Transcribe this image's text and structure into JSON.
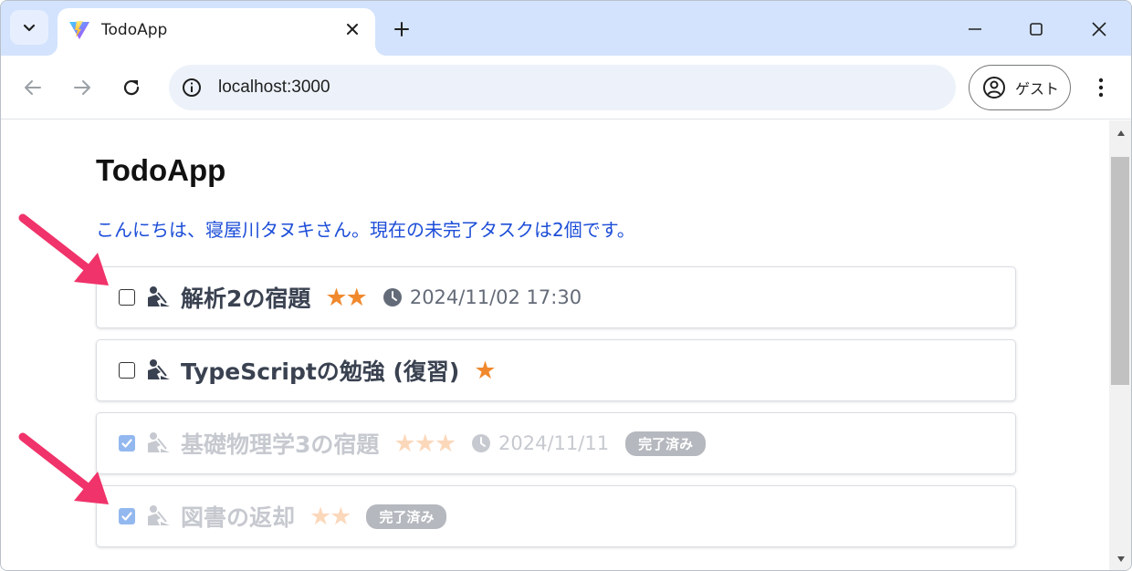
{
  "browser": {
    "tab_title": "TodoApp",
    "new_tab_label": "+",
    "url": "localhost:3000",
    "profile_label": "ゲスト"
  },
  "page": {
    "title": "TodoApp",
    "greeting": "こんにちは、寝屋川タヌキさん。現在の未完了タスクは2個です。"
  },
  "todos": [
    {
      "name": "解析2の宿題",
      "stars": "★★",
      "priority": 2,
      "due": "2024/11/02 17:30",
      "done": false
    },
    {
      "name": "TypeScriptの勉強 (復習)",
      "stars": "★",
      "priority": 1,
      "due": "",
      "done": false
    },
    {
      "name": "基礎物理学3の宿題",
      "stars": "★★★",
      "priority": 3,
      "due": "2024/11/11",
      "done": true,
      "badge": "完了済み"
    },
    {
      "name": "図書の返却",
      "stars": "★★",
      "priority": 2,
      "due": "",
      "done": true,
      "badge": "完了済み"
    }
  ],
  "colors": {
    "accent": "#1d4ed8",
    "star": "#f0892e",
    "tabstrip": "#d3e3fd",
    "annotation_arrow": "#f0336a"
  }
}
